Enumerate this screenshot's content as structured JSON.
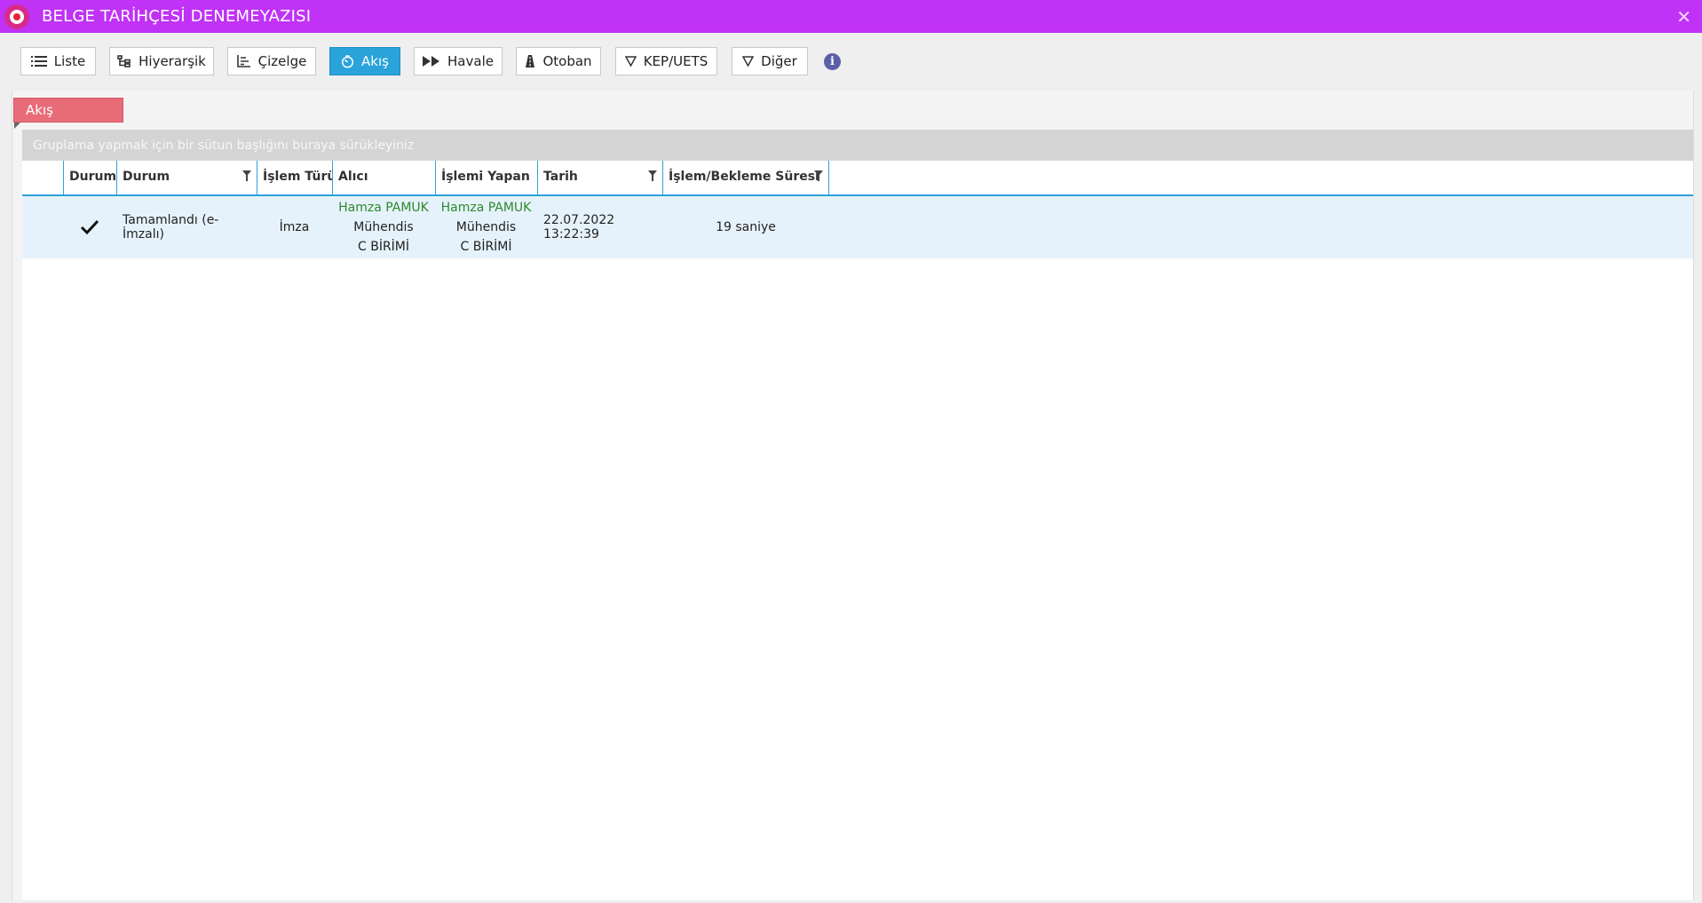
{
  "window": {
    "title": "BELGE TARİHÇESİ DENEMEYAZISI",
    "close_glyph": "✕",
    "accent_color": "#c032f5"
  },
  "toolbar": {
    "buttons": [
      {
        "label": "Liste",
        "icon": "list-icon"
      },
      {
        "label": "Hiyerarşik",
        "icon": "hierarchy-icon"
      },
      {
        "label": "Çizelge",
        "icon": "gantt-icon"
      },
      {
        "label": "Akış",
        "icon": "timer-icon",
        "active": true
      },
      {
        "label": "Havale",
        "icon": "fast-forward-icon"
      },
      {
        "label": "Otoban",
        "icon": "road-icon"
      },
      {
        "label": "KEP/UETS",
        "icon": "filter-icon"
      },
      {
        "label": "Diğer",
        "icon": "filter-icon"
      }
    ],
    "info_glyph": "i",
    "active_color": "#29a3da"
  },
  "section": {
    "tab_label": "Akış"
  },
  "grid": {
    "group_hint": "Gruplama yapmak için bir sütun başlığını buraya sürükleyiniz",
    "columns": [
      "",
      "Durum",
      "Durum",
      "İşlem Türü",
      "Alıcı",
      "İşlemi Yapan",
      "Tarih",
      "İşlem/Bekleme Süresi"
    ],
    "rows": [
      {
        "status_icon": "check-icon",
        "status_text": "Tamamlandı (e-İmzalı)",
        "operation_type": "İmza",
        "recipient": {
          "name": "Hamza PAMUK",
          "title": "Mühendis",
          "unit": "C BİRİMİ"
        },
        "performer": {
          "name": "Hamza PAMUK",
          "title": "Mühendis",
          "unit": "C BİRİMİ"
        },
        "date": "22.07.2022 13:22:39",
        "duration": "19 saniye"
      }
    ]
  }
}
